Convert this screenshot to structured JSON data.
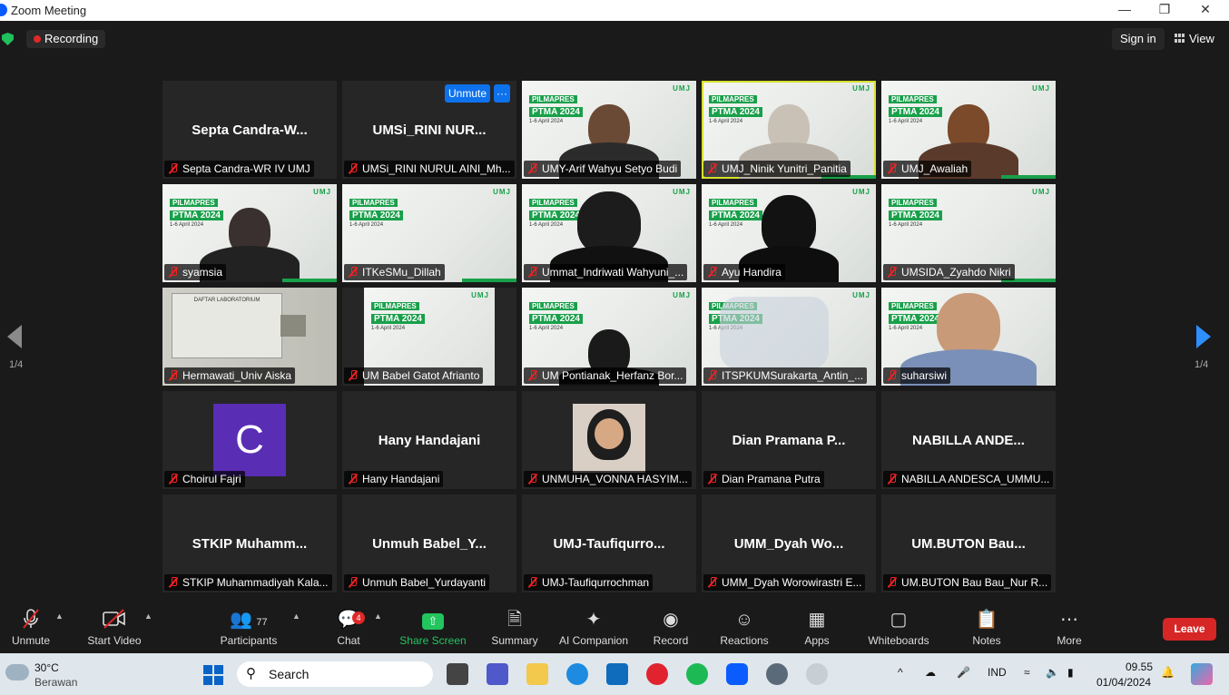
{
  "window": {
    "title": "Zoom Meeting",
    "minimize": "—",
    "restore": "❐",
    "close": "✕"
  },
  "topbar": {
    "recording": "Recording",
    "signin": "Sign in",
    "view": "View"
  },
  "pager": {
    "left": "1/4",
    "right": "1/4"
  },
  "tile_controls": {
    "unmute": "Unmute",
    "more": "···"
  },
  "banner": {
    "line1": "PILMAPRES",
    "line2": "PTMA 2024",
    "line3": "1-6 April 2024",
    "logos": "UMJ"
  },
  "tiles": [
    {
      "big": "Septa  Candra-W...",
      "name": "Septa Candra-WR IV UMJ"
    },
    {
      "big": "UMSi_RINI  NUR...",
      "name": "UMSi_RINI NURUL AINI_Mh..."
    },
    {
      "name": "UMY-Arif Wahyu Setyo Budi"
    },
    {
      "name": "UMJ_Ninik Yunitri_Panitia"
    },
    {
      "name": "UMJ_Awaliah"
    },
    {
      "name": "syamsia"
    },
    {
      "name": "ITKeSMu_Dillah"
    },
    {
      "name": "Ummat_Indriwati Wahyuni_..."
    },
    {
      "name": "Ayu Handira"
    },
    {
      "name": "UMSIDA_Zyahdo Nikri"
    },
    {
      "name": "Hermawati_Univ Aiska",
      "wall": "DAFTAR LABORATORIUM"
    },
    {
      "name": "UM Babel Gatot Afrianto"
    },
    {
      "name": "UM Pontianak_Herfanz Bor..."
    },
    {
      "name": "ITSPKUMSurakarta_Antin_..."
    },
    {
      "name": "suharsiwi"
    },
    {
      "name": "Choirul Fajri",
      "avatar": "C"
    },
    {
      "big": "Hany Handajani",
      "name": "Hany Handajani"
    },
    {
      "name": "UNMUHA_VONNA HASYIM..."
    },
    {
      "big": "Dian  Pramana  P...",
      "name": "Dian Pramana Putra"
    },
    {
      "big": "NABILLA  ANDE...",
      "name": "NABILLA ANDESCA_UMMU..."
    },
    {
      "big": "STKIP  Muhamm...",
      "name": "STKIP Muhammadiyah Kala..."
    },
    {
      "big": "Unmuh  Babel_Y...",
      "name": "Unmuh Babel_Yurdayanti"
    },
    {
      "big": "UMJ-Taufiqurro...",
      "name": "UMJ-Taufiqurrochman"
    },
    {
      "big": "UMM_Dyah  Wo...",
      "name": "UMM_Dyah Worowirastri E..."
    },
    {
      "big": "UM.BUTON  Bau...",
      "name": "UM.BUTON Bau Bau_Nur R..."
    }
  ],
  "toolbar": {
    "unmute": "Unmute",
    "start_video": "Start Video",
    "participants": "Participants",
    "participants_count": "77",
    "chat": "Chat",
    "chat_badge": "4",
    "share": "Share Screen",
    "summary": "Summary",
    "ai": "AI Companion",
    "record": "Record",
    "reactions": "Reactions",
    "apps": "Apps",
    "whiteboards": "Whiteboards",
    "notes": "Notes",
    "more": "More",
    "leave": "Leave"
  },
  "taskbar": {
    "temp": "30°C",
    "weather": "Berawan",
    "search": "Search",
    "lang": "IND",
    "time": "09.55",
    "date": "01/04/2024"
  },
  "colors": {
    "accent": "#0e72ed",
    "share_green": "#22c55e",
    "leave_red": "#d72626",
    "active_border": "#d8e02c",
    "banner_green": "#19a04a"
  }
}
